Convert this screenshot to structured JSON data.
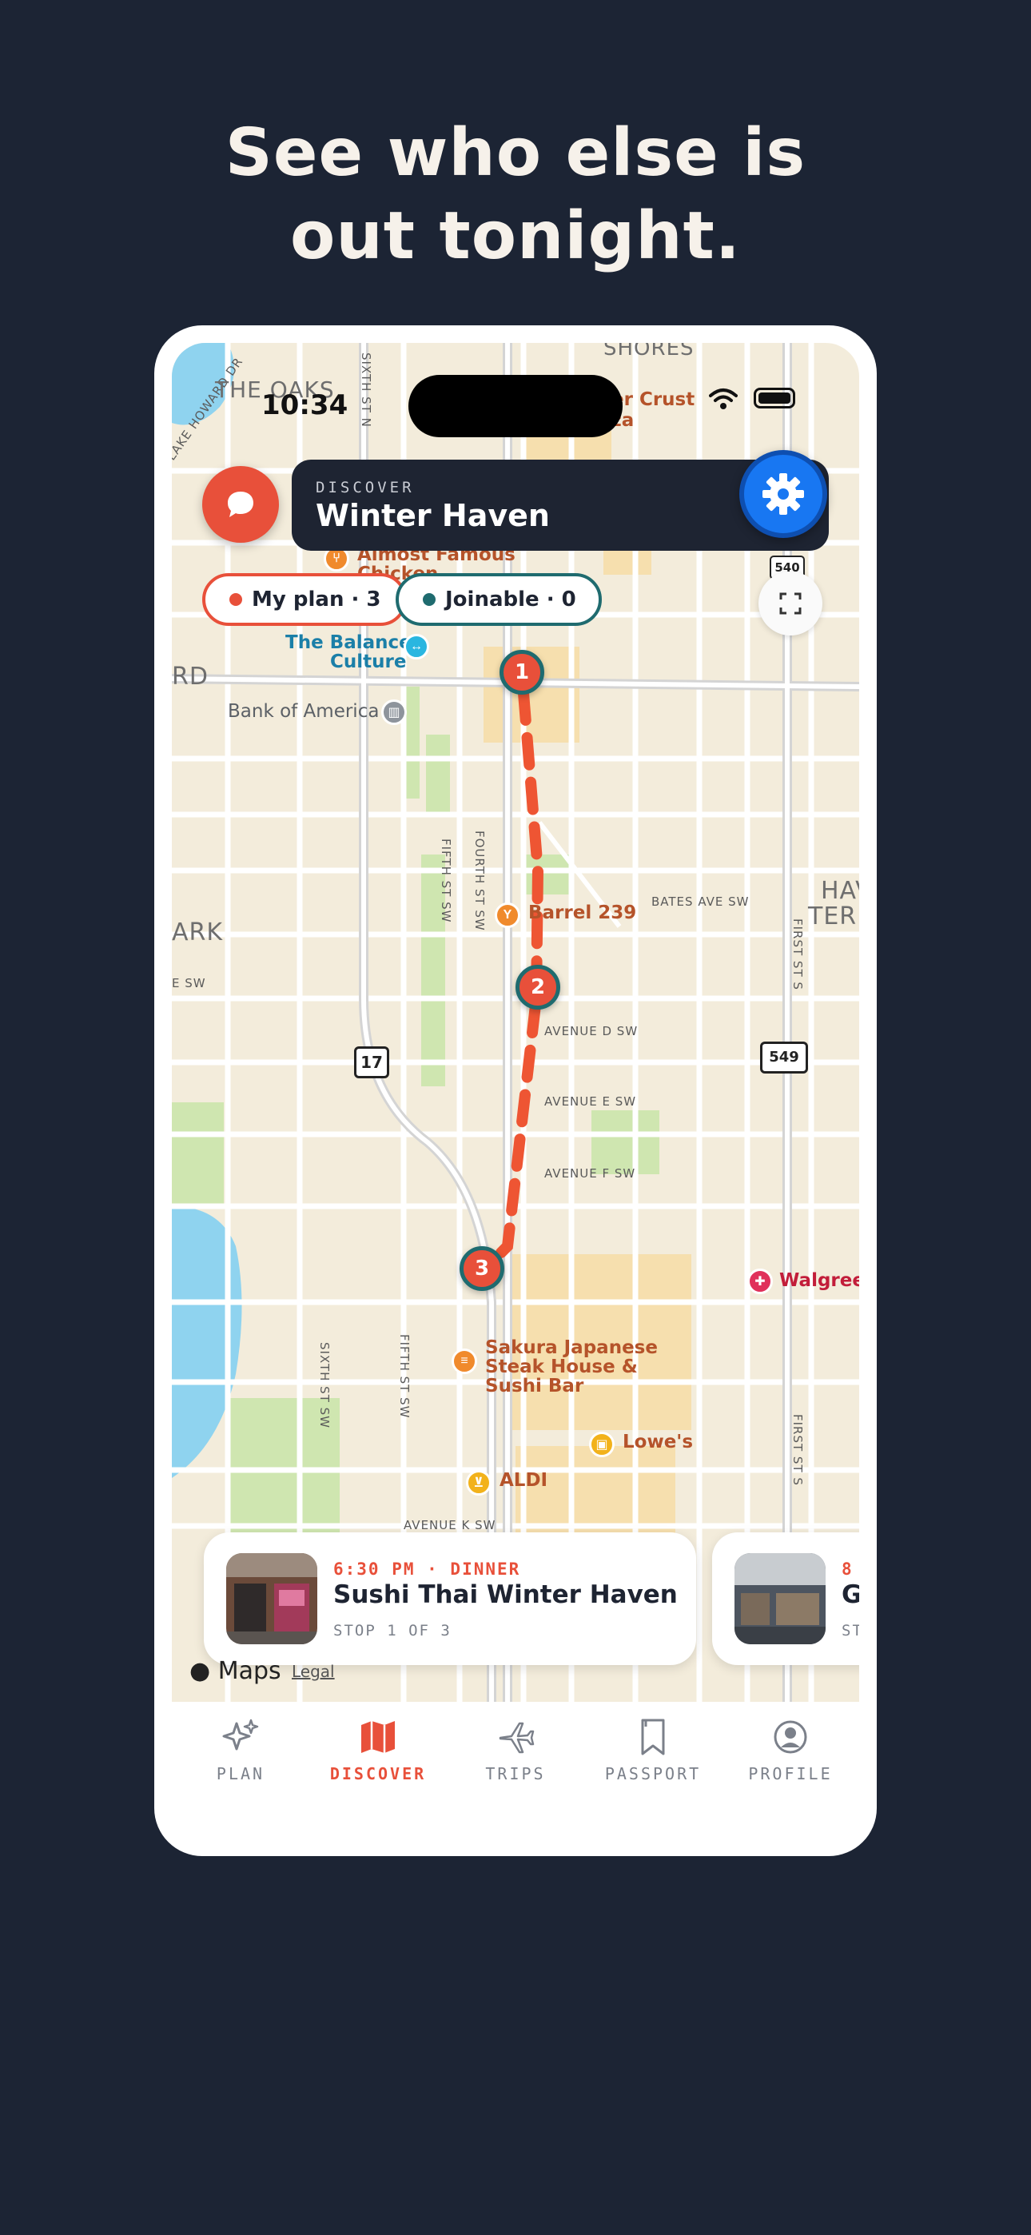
{
  "headline": {
    "line1": "See who else is",
    "line2": "out tonight."
  },
  "status_bar": {
    "time": "10:34"
  },
  "header": {
    "kicker": "DISCOVER",
    "city": "Winter Haven"
  },
  "chips": {
    "my_plan": "My plan · 3",
    "joinable": "Joinable · 0"
  },
  "map": {
    "streets": {
      "sixth_st_n": "SIXTH ST N",
      "lake_howard": "LAKE HOWARD DR",
      "fifth_st_sw": "FIFTH ST SW",
      "fourth_st_sw": "FOURTH ST SW",
      "bates_ave": "BATES AVE SW",
      "first_st_s": "FIRST ST S",
      "first_st_s_lower": "FIRST ST S",
      "ave_d": "AVENUE D SW",
      "ave_e": "AVENUE E SW",
      "ave_f": "AVENUE F SW",
      "ave_k": "AVENUE K SW",
      "sixth_st_sw": "SIXTH ST SW",
      "fifth_st_sw_lower": "FIFTH ST SW",
      "e_sw": "E SW"
    },
    "districts": {
      "the_oaks": "THE OAKS",
      "shores": "SHORES",
      "rd": "RD",
      "ark": "ARK",
      "hav": "HAV",
      "terr": "TERR"
    },
    "route_shields": {
      "us17": "17",
      "sr549": "549",
      "sr540": "540"
    },
    "pois": {
      "crust": "er Crust",
      "zza": "zza",
      "almost_famous_1": "Almost Famous",
      "almost_famous_2": "Chicken",
      "balance_1": "The Balance",
      "balance_2": "Culture",
      "bank": "Bank of America",
      "barrel": "Barrel 239",
      "walgreens": "Walgreens",
      "sakura_1": "Sakura Japanese",
      "sakura_2": "Steak House &",
      "sakura_3": "Sushi Bar",
      "lowes": "Lowe's",
      "aldi": "ALDI"
    },
    "stops": [
      "1",
      "2",
      "3"
    ],
    "attribution": {
      "logo": " Maps",
      "legal": "Legal"
    }
  },
  "cards": [
    {
      "time": "6:30 PM · DINNER",
      "name": "Sushi Thai Winter Haven",
      "sub": "STOP 1 OF 3"
    },
    {
      "time": "8",
      "name": "G",
      "sub": "ST"
    }
  ],
  "tabs": [
    {
      "label": "PLAN",
      "icon": "sparkles-icon",
      "active": false
    },
    {
      "label": "DISCOVER",
      "icon": "map-icon",
      "active": true
    },
    {
      "label": "TRIPS",
      "icon": "plane-icon",
      "active": false
    },
    {
      "label": "PASSPORT",
      "icon": "bookmark-icon",
      "active": false
    },
    {
      "label": "PROFILE",
      "icon": "person-icon",
      "active": false
    }
  ],
  "colors": {
    "background": "#1c2434",
    "accent": "#e8503a",
    "teal": "#1f6b6f",
    "gear_blue": "#1877f2",
    "dark_bar": "#1e2432"
  }
}
